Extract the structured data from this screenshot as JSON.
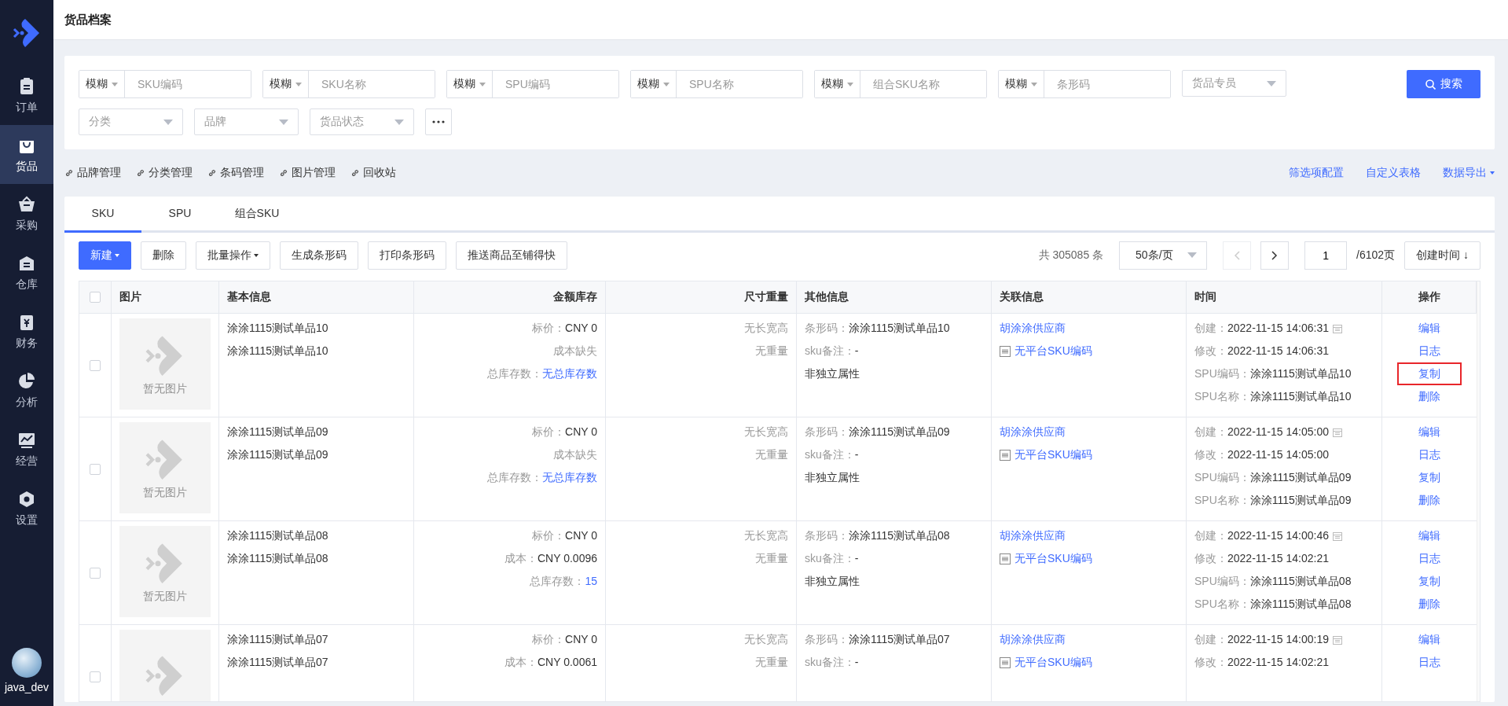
{
  "sidebar": {
    "items": [
      {
        "label": "订单",
        "selected": false
      },
      {
        "label": "货品",
        "selected": true
      },
      {
        "label": "采购",
        "selected": false
      },
      {
        "label": "仓库",
        "selected": false
      },
      {
        "label": "财务",
        "selected": false
      },
      {
        "label": "分析",
        "selected": false
      },
      {
        "label": "经营",
        "selected": false
      },
      {
        "label": "设置",
        "selected": false
      }
    ],
    "user": {
      "name": "java_dev"
    }
  },
  "page_title": "货品档案",
  "filters": {
    "fuzzy_fields": [
      {
        "mode": "模糊",
        "placeholder": "SKU编码"
      },
      {
        "mode": "模糊",
        "placeholder": "SKU名称"
      },
      {
        "mode": "模糊",
        "placeholder": "SPU编码"
      },
      {
        "mode": "模糊",
        "placeholder": "SPU名称"
      },
      {
        "mode": "模糊",
        "placeholder": "组合SKU名称"
      },
      {
        "mode": "模糊",
        "placeholder": "条形码"
      }
    ],
    "selects": [
      {
        "placeholder": "货品专员"
      },
      {
        "placeholder": "分类"
      },
      {
        "placeholder": "品牌"
      },
      {
        "placeholder": "货品状态"
      }
    ],
    "search_button": "搜索"
  },
  "links": {
    "left": [
      {
        "label": "品牌管理"
      },
      {
        "label": "分类管理"
      },
      {
        "label": "条码管理"
      },
      {
        "label": "图片管理"
      },
      {
        "label": "回收站"
      }
    ],
    "right": [
      {
        "label": "筛选项配置",
        "dropdown": false
      },
      {
        "label": "自定义表格",
        "dropdown": false
      },
      {
        "label": "数据导出",
        "dropdown": true
      }
    ]
  },
  "tabs": [
    {
      "label": "SKU",
      "selected": true
    },
    {
      "label": "SPU",
      "selected": false
    },
    {
      "label": "组合SKU",
      "selected": false
    }
  ],
  "toolbar": {
    "buttons": [
      {
        "label": "新建",
        "primary": true,
        "dropdown": true
      },
      {
        "label": "删除",
        "primary": false,
        "dropdown": false
      },
      {
        "label": "批量操作",
        "primary": false,
        "dropdown": true
      },
      {
        "label": "生成条形码",
        "primary": false,
        "dropdown": false
      },
      {
        "label": "打印条形码",
        "primary": false,
        "dropdown": false
      },
      {
        "label": "推送商品至铺得快",
        "primary": false,
        "dropdown": false
      }
    ],
    "total": "共 305085 条",
    "page_size": "50条/页",
    "prev_disabled": true,
    "next_disabled": false,
    "page": "1",
    "page_count": "/6102页",
    "sort": "创建时间 ↓"
  },
  "table": {
    "header_checked": false,
    "columns": [
      "图片",
      "基本信息",
      "金额库存",
      "尺寸重量",
      "其他信息",
      "关联信息",
      "时间",
      "操作"
    ],
    "rows": [
      {
        "checked": false,
        "image_text": "暂无图片",
        "basic": [
          "涂涂1115测试单品10",
          "涂涂1115测试单品10"
        ],
        "amount": [
          {
            "kind": "value",
            "label": "标价：",
            "value": "CNY 0"
          },
          {
            "kind": "note",
            "value": "成本缺失"
          },
          {
            "kind": "link",
            "label": "总库存数：",
            "value": "无总库存数"
          }
        ],
        "size": [
          "无长宽高",
          "无重量"
        ],
        "other": [
          {
            "label": "条形码：",
            "value": "涂涂1115测试单品10"
          },
          {
            "label": "sku备注：",
            "value": "-"
          },
          {
            "value": "非独立属性"
          }
        ],
        "supplier": "胡涂涂供应商",
        "platform_sku": "无平台SKU编码",
        "time": [
          {
            "label": "创建：",
            "value": "2022-11-15 14:06:31",
            "calendar": true
          },
          {
            "label": "修改：",
            "value": "2022-11-15 14:06:31",
            "calendar": false
          },
          {
            "label": "SPU编码：",
            "value": "涂涂1115测试单品10",
            "calendar": false
          },
          {
            "label": "SPU名称：",
            "value": "涂涂1115测试单品10",
            "calendar": false
          }
        ],
        "actions": [
          {
            "label": "编辑",
            "highlighted": false
          },
          {
            "label": "日志",
            "highlighted": false
          },
          {
            "label": "复制",
            "highlighted": true
          },
          {
            "label": "删除",
            "highlighted": false
          }
        ]
      },
      {
        "checked": false,
        "image_text": "暂无图片",
        "basic": [
          "涂涂1115测试单品09",
          "涂涂1115测试单品09"
        ],
        "amount": [
          {
            "kind": "value",
            "label": "标价：",
            "value": "CNY 0"
          },
          {
            "kind": "note",
            "value": "成本缺失"
          },
          {
            "kind": "link",
            "label": "总库存数：",
            "value": "无总库存数"
          }
        ],
        "size": [
          "无长宽高",
          "无重量"
        ],
        "other": [
          {
            "label": "条形码：",
            "value": "涂涂1115测试单品09"
          },
          {
            "label": "sku备注：",
            "value": "-"
          },
          {
            "value": "非独立属性"
          }
        ],
        "supplier": "胡涂涂供应商",
        "platform_sku": "无平台SKU编码",
        "time": [
          {
            "label": "创建：",
            "value": "2022-11-15 14:05:00",
            "calendar": true
          },
          {
            "label": "修改：",
            "value": "2022-11-15 14:05:00",
            "calendar": false
          },
          {
            "label": "SPU编码：",
            "value": "涂涂1115测试单品09",
            "calendar": false
          },
          {
            "label": "SPU名称：",
            "value": "涂涂1115测试单品09",
            "calendar": false
          }
        ],
        "actions": [
          {
            "label": "编辑",
            "highlighted": false
          },
          {
            "label": "日志",
            "highlighted": false
          },
          {
            "label": "复制",
            "highlighted": false
          },
          {
            "label": "删除",
            "highlighted": false
          }
        ]
      },
      {
        "checked": false,
        "image_text": "暂无图片",
        "basic": [
          "涂涂1115测试单品08",
          "涂涂1115测试单品08"
        ],
        "amount": [
          {
            "kind": "value",
            "label": "标价：",
            "value": "CNY 0"
          },
          {
            "kind": "value",
            "label": "成本：",
            "value": "CNY 0.0096"
          },
          {
            "kind": "link",
            "label": "总库存数：",
            "value": "15"
          }
        ],
        "size": [
          "无长宽高",
          "无重量"
        ],
        "other": [
          {
            "label": "条形码：",
            "value": "涂涂1115测试单品08"
          },
          {
            "label": "sku备注：",
            "value": "-"
          },
          {
            "value": "非独立属性"
          }
        ],
        "supplier": "胡涂涂供应商",
        "platform_sku": "无平台SKU编码",
        "time": [
          {
            "label": "创建：",
            "value": "2022-11-15 14:00:46",
            "calendar": true
          },
          {
            "label": "修改：",
            "value": "2022-11-15 14:02:21",
            "calendar": false
          },
          {
            "label": "SPU编码：",
            "value": "涂涂1115测试单品08",
            "calendar": false
          },
          {
            "label": "SPU名称：",
            "value": "涂涂1115测试单品08",
            "calendar": false
          }
        ],
        "actions": [
          {
            "label": "编辑",
            "highlighted": false
          },
          {
            "label": "日志",
            "highlighted": false
          },
          {
            "label": "复制",
            "highlighted": false
          },
          {
            "label": "删除",
            "highlighted": false
          }
        ]
      },
      {
        "checked": false,
        "basic": [
          "涂涂1115测试单品07",
          "涂涂1115测试单品07"
        ],
        "amount": [
          {
            "kind": "value",
            "label": "标价：",
            "value": "CNY 0"
          },
          {
            "kind": "value",
            "label": "成本：",
            "value": "CNY 0.0061"
          }
        ],
        "size": [
          "无长宽高",
          "无重量"
        ],
        "other": [
          {
            "label": "条形码：",
            "value": "涂涂1115测试单品07"
          },
          {
            "label": "sku备注：",
            "value": "-"
          }
        ],
        "supplier": "胡涂涂供应商",
        "platform_sku": "无平台SKU编码",
        "time": [
          {
            "label": "创建：",
            "value": "2022-11-15 14:00:19",
            "calendar": true
          },
          {
            "label": "修改：",
            "value": "2022-11-15 14:02:21",
            "calendar": false
          }
        ],
        "actions": [
          {
            "label": "编辑",
            "highlighted": false
          },
          {
            "label": "日志",
            "highlighted": false
          }
        ]
      }
    ]
  }
}
